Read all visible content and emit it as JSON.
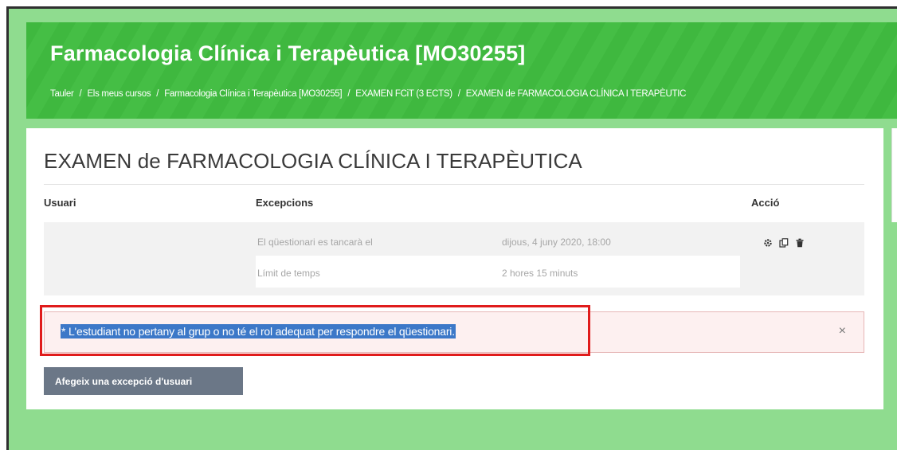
{
  "header": {
    "course_title": "Farmacologia Clínica i Terapèutica [MO30255]",
    "breadcrumb": [
      "Tauler",
      "Els meus cursos",
      "Farmacologia Clínica i Terapèutica [MO30255]",
      "EXAMEN FCiT (3 ECTS)",
      "EXAMEN de FARMACOLOGIA CLÍNICA I TERAPÈUTIC"
    ],
    "separator": "/"
  },
  "main": {
    "title": "EXAMEN de FARMACOLOGIA CLÍNICA I TERAPÈUTICA",
    "table": {
      "headers": {
        "user": "Usuari",
        "exceptions": "Excepcions",
        "action": "Acció"
      },
      "rows": [
        {
          "exceptions": [
            {
              "label": "El qüestionari es tancarà el",
              "value": "dijous, 4 juny 2020, 18:00"
            },
            {
              "label": "Límit de temps",
              "value": "2 hores 15 minuts"
            }
          ],
          "actions": [
            "gear-icon",
            "copy-icon",
            "trash-icon"
          ]
        }
      ]
    },
    "alert": {
      "message": "* L'estudiant no pertany al grup o no té el rol adequat per respondre el qüestionari.",
      "close_label": "×"
    },
    "add_button_label": "Afegeix una excepció d'usuari"
  },
  "colors": {
    "page_background": "#8fdc8f",
    "header_green": "#3fb83f",
    "alert_background": "#fdf0f0",
    "highlight_border": "#e01b1b",
    "selection_blue": "#3c78c8",
    "button_grey": "#6b7787"
  }
}
